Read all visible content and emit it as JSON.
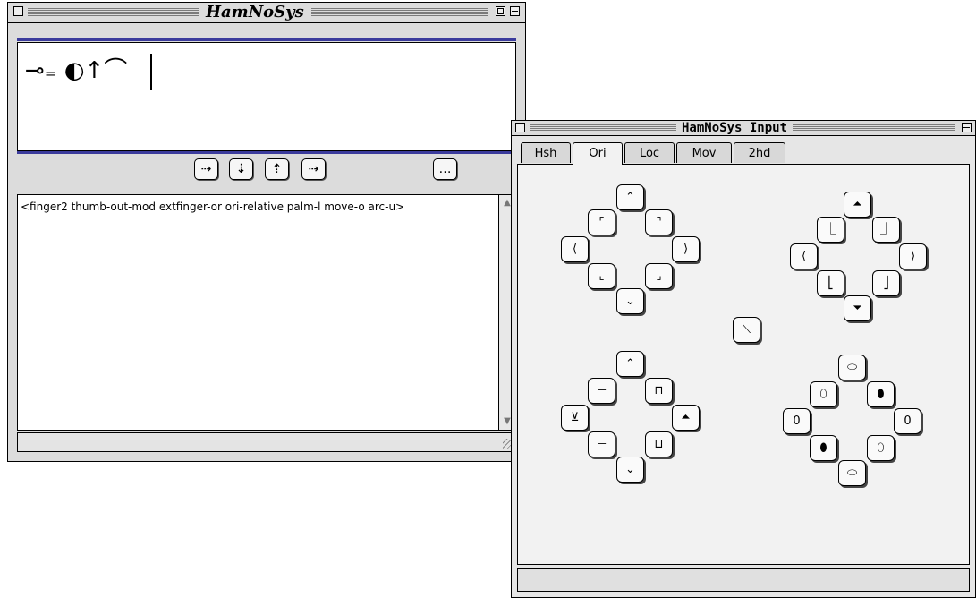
{
  "editor_window": {
    "title": "HamNoSys",
    "notation_glyphs": "⊸₌ ◐↑⌒",
    "toolbar": [
      {
        "name": "insert-right-button",
        "glyph": "⇢"
      },
      {
        "name": "insert-down-button",
        "glyph": "⇣"
      },
      {
        "name": "insert-up-button",
        "glyph": "⇡"
      },
      {
        "name": "insert-after-button",
        "glyph": "⇢"
      },
      {
        "name": "more-button",
        "glyph": "…"
      }
    ],
    "text": "<finger2 thumb-out-mod extfinger-or ori-relative palm-l move-o arc-u>"
  },
  "input_window": {
    "title": "HamNoSys Input",
    "tabs": [
      "Hsh",
      "Ori",
      "Loc",
      "Mov",
      "2hd"
    ],
    "active_tab": "Ori",
    "groups": {
      "top_left": [
        "⌃",
        "⌜",
        "⌝",
        "⟨",
        "⟩",
        "⌞",
        "⌟",
        "⌄"
      ],
      "top_right": [
        "⏶",
        "⎿",
        "⏌",
        "⟨",
        "⟩",
        "⎣",
        "⎦",
        "⏷"
      ],
      "center": [
        "⟍"
      ],
      "bottom_left": [
        "⌃",
        "⊢",
        "⊓",
        "⊻",
        "⏶",
        "⊢",
        "⊔",
        "⌄"
      ],
      "bottom_right": [
        "⬭",
        "⬯",
        "⬮",
        "0",
        "0",
        "⬮",
        "⬯",
        "⬭"
      ]
    }
  }
}
